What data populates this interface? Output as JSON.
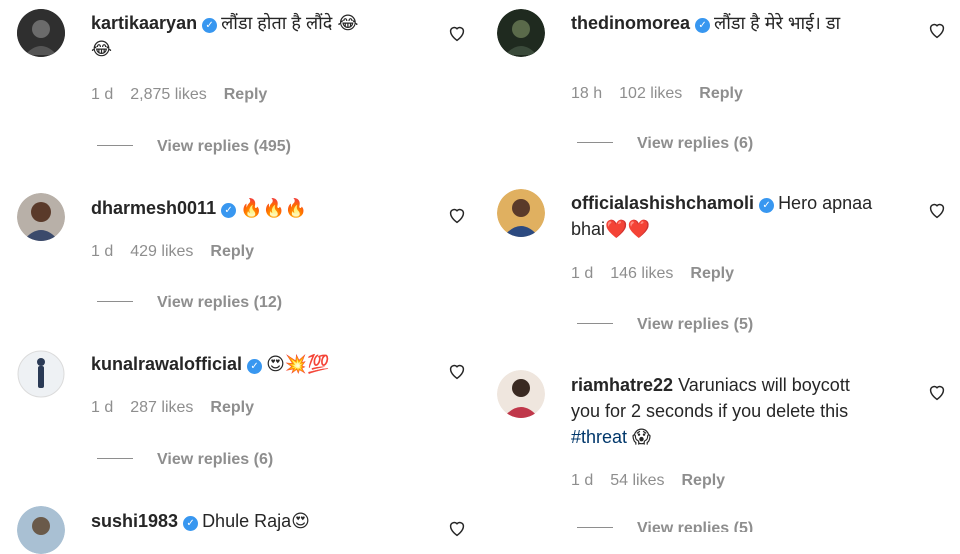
{
  "left": [
    {
      "user": "kartikaaryan",
      "verified": true,
      "text": "लौंडा होता है लौंदे 😂",
      "text2": "😂",
      "age": "1 d",
      "likes": "2,875 likes",
      "reply": "Reply",
      "view_replies": "View replies (495)",
      "avatar_color": "#3a3a3a"
    },
    {
      "user": "dharmesh0011",
      "verified": true,
      "text": "🔥🔥🔥",
      "age": "1 d",
      "likes": "429 likes",
      "reply": "Reply",
      "view_replies": "View replies (12)",
      "avatar_color": "#6a4a3a"
    },
    {
      "user": "kunalrawalofficial",
      "verified": true,
      "text": "😍💥💯",
      "age": "1 d",
      "likes": "287 likes",
      "reply": "Reply",
      "view_replies": "View replies (6)",
      "avatar_color": "#e8ecef"
    },
    {
      "user": "sushi1983",
      "verified": true,
      "text": "Dhule Raja😍",
      "avatar_color": "#8aa7bf"
    }
  ],
  "right": [
    {
      "user": "thedinomorea",
      "verified": true,
      "text": "लौंडा है मेरे भाई। डा",
      "text2": "डा",
      "age": "18 h",
      "likes": "102 likes",
      "reply": "Reply",
      "view_replies": "View replies (6)",
      "avatar_color": "#2d3a2d"
    },
    {
      "user": "officialashishchamoli",
      "verified": true,
      "text": "Hero apnaa",
      "text2": "bhai❤️❤️",
      "age": "1 d",
      "likes": "146 likes",
      "reply": "Reply",
      "view_replies": "View replies (5)",
      "avatar_color": "#3a5a8a"
    },
    {
      "user": "riamhatre22",
      "verified": false,
      "text": "Varuniacs will boycott",
      "text2": "you for 2 seconds if you delete this",
      "hashtag": "#threat",
      "emoji3": "😱",
      "age": "1 d",
      "likes": "54 likes",
      "reply": "Reply",
      "view_replies": "View replies (5)",
      "avatar_color": "#c0374a"
    }
  ],
  "colors": {
    "text": "#262626",
    "muted": "#8e8e8e",
    "verified": "#3897f0",
    "hashtag": "#00376b"
  }
}
